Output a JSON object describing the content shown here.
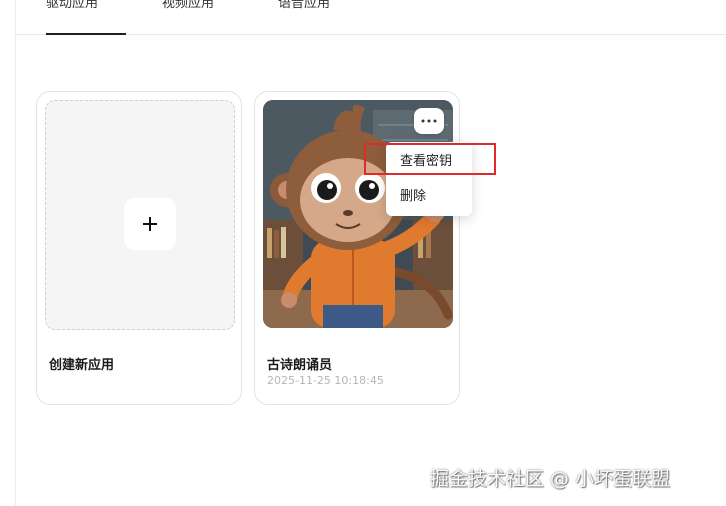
{
  "tabs": [
    {
      "label": "驱动应用",
      "active": true
    },
    {
      "label": "视频应用",
      "active": false
    },
    {
      "label": "语音应用",
      "active": false
    }
  ],
  "create_card": {
    "title": "创建新应用",
    "icon": "plus-icon"
  },
  "app_card": {
    "title": "古诗朗诵员",
    "time": "2025-11-25 10:18:45",
    "thumbnail": "cartoon-monkey-image",
    "more_icon": "ellipsis-icon"
  },
  "context_menu": {
    "items": [
      {
        "label": "查看密钥"
      },
      {
        "label": "删除"
      }
    ]
  },
  "annotation": {
    "highlight_color": "#e02a2a"
  },
  "watermark": "掘金技术社区 @ 小坏蛋联盟"
}
